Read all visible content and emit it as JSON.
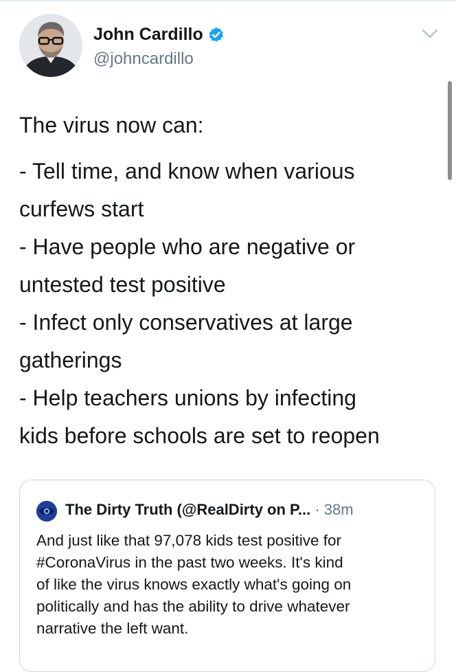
{
  "author": {
    "name": "John Cardillo",
    "handle": "@johncardillo",
    "verified": true
  },
  "tweet": {
    "lines": [
      "The virus now can:",
      "- Tell time, and know when various",
      "curfews start",
      "- Have people who are negative or",
      "untested test positive",
      "- Infect only conservatives at large",
      "gatherings",
      "- Help teachers unions by infecting",
      "kids before schools are set to reopen"
    ]
  },
  "quoted": {
    "name": "The Dirty Truth (@RealDirty on P...",
    "separator": " · ",
    "time": "38m",
    "lines": [
      "And just like that 97,078 kids test positive for",
      "#CoronaVirus in the past two weeks. It's kind",
      "of like the virus knows exactly what's going on",
      "politically and has the ability to drive whatever",
      "narrative the left want."
    ]
  },
  "icons": {
    "verified": "verified-badge-icon",
    "menu": "chevron-down-icon"
  },
  "colors": {
    "text": "#14171a",
    "secondary": "#657786",
    "verified": "#1da1f2",
    "border": "#ccd6dd"
  }
}
